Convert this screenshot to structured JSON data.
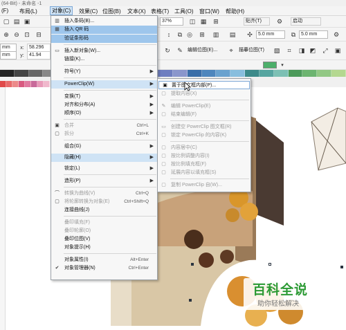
{
  "title_bar": {
    "text": "(64-Bit) - 未命名 -1"
  },
  "menubar": {
    "items": [
      "(F)",
      "布局(L)",
      "对象(C)",
      "效果(C)",
      "位图(B)",
      "文本(X)",
      "表格(T)",
      "工具(O)",
      "窗口(W)",
      "帮助(H)"
    ]
  },
  "toolbar": {
    "zoom_value": "37%",
    "snap_label": "贴齐(T)",
    "launch_label": "启动",
    "x_value": "58.296 mm",
    "y_value": "41.94 mm",
    "mm_field": "mm",
    "mm_field2": "mm",
    "nudge_value1": "5.0 mm",
    "nudge_value2": "5.0 mm",
    "edit_bitmap": "编辑位图(E)...",
    "trace_bitmap": "描摹位图(T)"
  },
  "object_menu": {
    "items": [
      {
        "label": "插入条码(B)...",
        "icon": "barcode-icon"
      },
      {
        "label": "插入 QR 码",
        "icon": "qr-icon"
      },
      {
        "label": "验证条形码",
        "icon": ""
      },
      {
        "label": "插入新对象(W)...",
        "icon": "insert-object-icon"
      },
      {
        "label": "链接(K)...",
        "icon": ""
      },
      {
        "label": "符号(Y)",
        "arrow": "▶"
      },
      {
        "label": "PowerClip(W)",
        "arrow": "▶"
      },
      {
        "label": "变换(T)",
        "arrow": "▶"
      },
      {
        "label": "对齐和分布(A)",
        "arrow": "▶"
      },
      {
        "label": "顺序(O)",
        "arrow": "▶"
      },
      {
        "label": "合并",
        "shortcut": "Ctrl+L"
      },
      {
        "label": "拆分",
        "shortcut": "Ctrl+K"
      },
      {
        "label": "组合(G)",
        "arrow": "▶"
      },
      {
        "label": "隐藏(H)",
        "arrow": "▶"
      },
      {
        "label": "锁定(L)",
        "arrow": "▶"
      },
      {
        "label": "造形(P)",
        "arrow": "▶"
      },
      {
        "label": "转换为曲线(V)",
        "shortcut": "Ctrl+Q"
      },
      {
        "label": "将轮廓转换为对象(E)",
        "shortcut": "Ctrl+Shift+Q"
      },
      {
        "label": "连接曲线(J)"
      },
      {
        "label": "叠印填充(F)"
      },
      {
        "label": "叠印轮廓(O)"
      },
      {
        "label": "叠印位图(V)"
      },
      {
        "label": "对象提示(H)"
      },
      {
        "label": "对象属性(I)",
        "shortcut": "Alt+Enter"
      },
      {
        "label": "对象管理器(N)",
        "shortcut": "Ctrl+Enter"
      }
    ]
  },
  "powerclip_submenu": {
    "items": [
      "置于图文框内部(P)...",
      "提取内容(X)",
      "编辑 PowerClip(E)",
      "结束编辑(F)",
      "创建空 PowerClip 图文框(R)",
      "锁定 PowerClip 的内容(K)",
      "内容居中(C)",
      "按比例调整内容(I)",
      "按比例填充框(F)",
      "延展内容以填充框(S)",
      "复制 PowerClip 自(W)..."
    ]
  },
  "watermark": {
    "title": "百科全说",
    "subtitle": "助你轻松解决"
  }
}
